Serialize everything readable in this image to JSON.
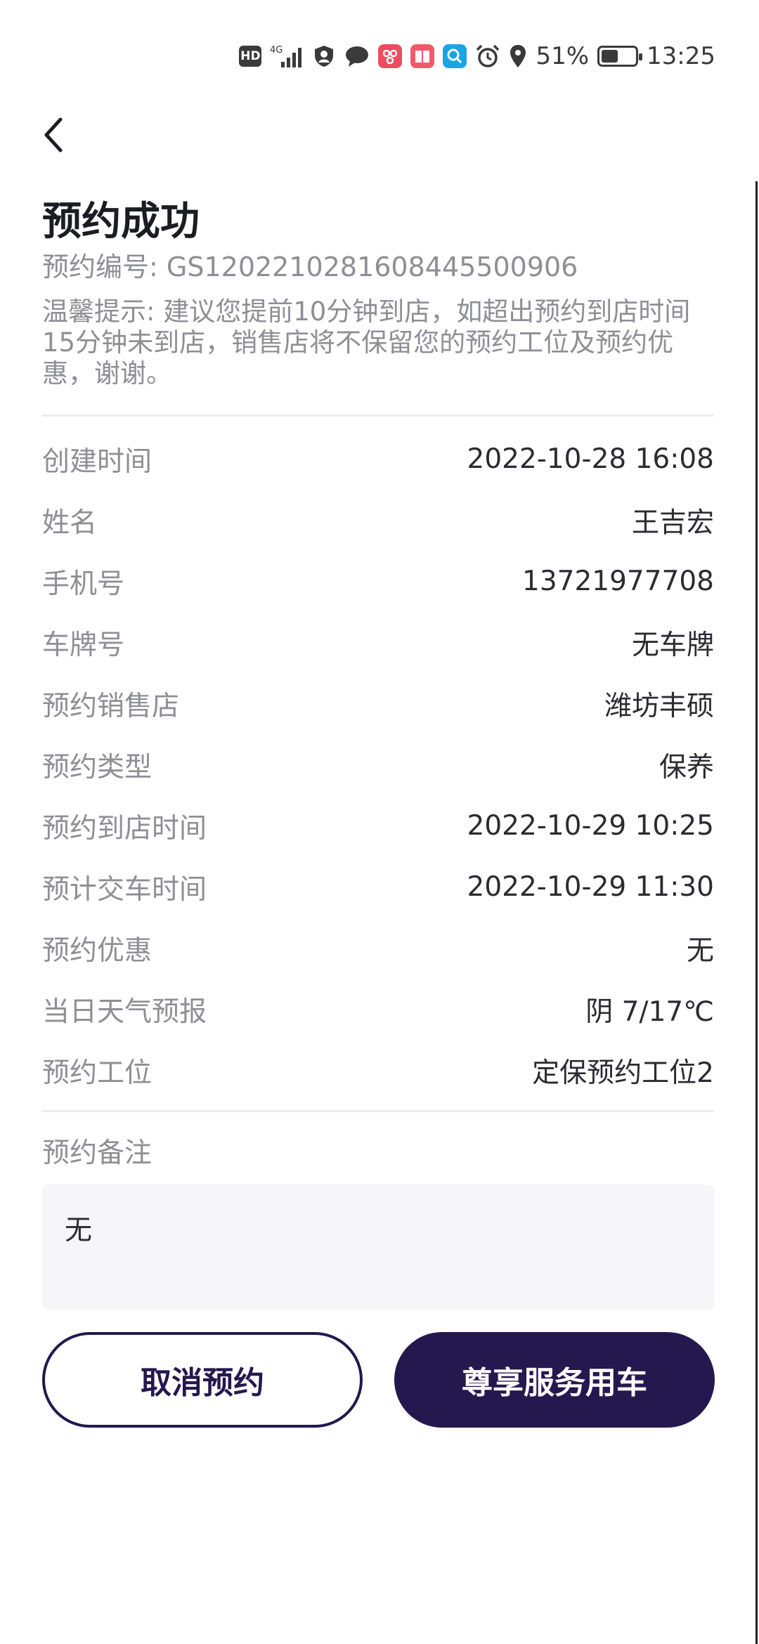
{
  "status_bar": {
    "battery_text": "51%",
    "battery_level": 0.51,
    "time": "13:25",
    "hd_label": "HD",
    "net_label": "4G"
  },
  "header": {
    "title": "预约成功",
    "order_number_label": "预约编号:",
    "order_number": "GS120221028160844550​0906",
    "tip": "温馨提示: 建议您提前10分钟到店，如超出预约到店时间15分钟未到店，销售店将不保留您的预约工位及预约优惠，谢谢。"
  },
  "details": [
    {
      "label": "创建时间",
      "value": "2022-10-28 16:08"
    },
    {
      "label": "姓名",
      "value": "王吉宏"
    },
    {
      "label": "手机号",
      "value": "13721977708"
    },
    {
      "label": "车牌号",
      "value": "无车牌"
    },
    {
      "label": "预约销售店",
      "value": "潍坊丰硕"
    },
    {
      "label": "预约类型",
      "value": "保养"
    },
    {
      "label": "预约到店时间",
      "value": "2022-10-29 10:25"
    },
    {
      "label": "预计交车时间",
      "value": "2022-10-29 11:30"
    },
    {
      "label": "预约优惠",
      "value": "无"
    },
    {
      "label": "当日天气预报",
      "value": "阴 7/17℃"
    },
    {
      "label": "预约工位",
      "value": "定保预约工位2"
    }
  ],
  "remark": {
    "label": "预约备注",
    "value": "无"
  },
  "actions": {
    "cancel_label": "取消预约",
    "primary_label": "尊享服务用车"
  },
  "colors": {
    "brand": "#24184f",
    "muted_text": "#8e8e96",
    "remark_bg": "#f6f6f8"
  }
}
